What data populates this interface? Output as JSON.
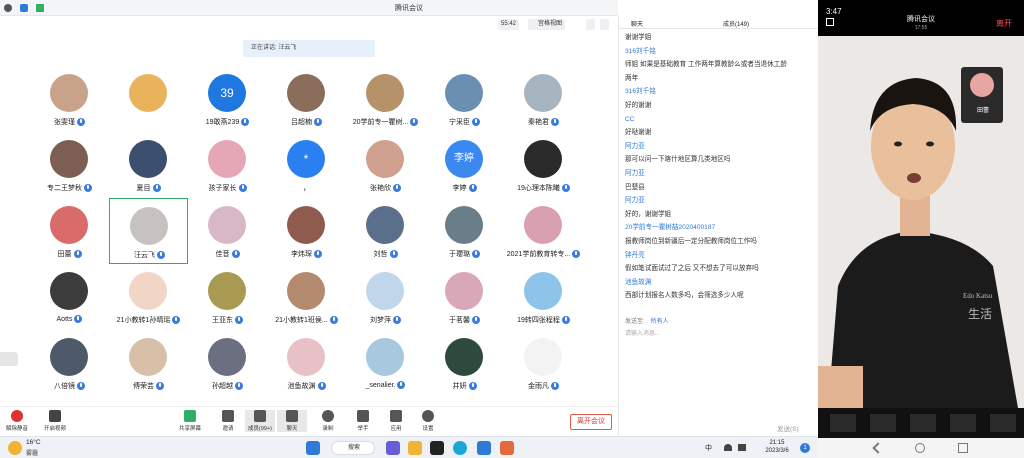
{
  "app": {
    "title": "腾讯会议"
  },
  "toolbar": {
    "timer": "55:42",
    "view_label": "宫格视图"
  },
  "speaking": "正在讲话: 汪云飞",
  "participants": [
    [
      "张雯瑾",
      "",
      "19敢燕239",
      "吕超楠",
      "20学前专一瞿树...",
      "宁采臣",
      "秦艳君"
    ],
    [
      "专二王梦秋",
      "夏目",
      "孩子家长",
      "，",
      "张艳欣",
      "李婷",
      "19心理本陈曦"
    ],
    [
      "田蕾",
      "汪云飞",
      "佳音",
      "李炜琛",
      "刘哲",
      "于瓔璐",
      "2021学前教育转专..."
    ],
    [
      "Aotts",
      "21小教转1孙晴瑶",
      "王亚东",
      "21小教转1班侯...",
      "刘梦萍",
      "于茗馨",
      "19转四张程程"
    ],
    [
      "八倍镜",
      "傅荣芸",
      "孙超越",
      "池鱼故渊",
      "_senalier.",
      "井妍",
      "金雨凡"
    ]
  ],
  "avatar_badges": {
    "number": "39",
    "text": "李婷",
    "star": "*"
  },
  "bottom_toolbar": {
    "mute": "解除静音",
    "video": "开启视频",
    "share": "共享屏幕",
    "invite": "邀请",
    "members": "成员(99+)",
    "chat": "聊天",
    "record": "录制",
    "hand": "举手",
    "apps": "应用",
    "settings": "设置",
    "leave": "离开会议"
  },
  "chat": {
    "tab_chat": "聊天",
    "tab_members": "成员(149)",
    "messages": [
      {
        "type": "text",
        "value": "谢谢学姐"
      },
      {
        "type": "user",
        "value": "316刘千铭"
      },
      {
        "type": "text",
        "value": "师姐 如果是基础教育 工作两年算教龄么或者当退休工龄"
      },
      {
        "type": "text",
        "value": "两年"
      },
      {
        "type": "user",
        "value": "316刘千铭"
      },
      {
        "type": "text",
        "value": "好的谢谢"
      },
      {
        "type": "user",
        "value": "CC"
      },
      {
        "type": "text",
        "value": "好哒谢谢"
      },
      {
        "type": "user",
        "value": "阿力亚"
      },
      {
        "type": "text",
        "value": "那可以问一下喀什地区算几类地区吗"
      },
      {
        "type": "user",
        "value": "阿力亚"
      },
      {
        "type": "text",
        "value": "巴楚县"
      },
      {
        "type": "user",
        "value": "阿力亚"
      },
      {
        "type": "text",
        "value": "好的，谢谢学姐"
      },
      {
        "type": "user",
        "value": "20学前专一瞿树喆2020400187"
      },
      {
        "type": "text",
        "value": "报教师岗位到新疆后一定分配教师岗位工作吗"
      },
      {
        "type": "user",
        "value": "钟丹亮"
      },
      {
        "type": "text",
        "value": "假如笔试面试过了之后 又不想去了可以放弃吗"
      },
      {
        "type": "user",
        "value": "池鱼故渊"
      },
      {
        "type": "text",
        "value": "西部计划报名人数多吗，会筛选多少人呢"
      }
    ],
    "send_to_label": "发送至:",
    "send_to_value": "所有人",
    "input_placeholder": "请输入消息...",
    "send_button": "发送(S)"
  },
  "phone": {
    "time": "3:47",
    "title": "腾讯会议",
    "subtitle": "17:55",
    "leave": "离开",
    "pip_name": "田蕾",
    "shirt_text": "Edo Katsu",
    "shirt_logo": "生活"
  },
  "taskbar": {
    "weather_temp": "16°C",
    "weather_desc": "雾霾",
    "search": "搜索",
    "ime": "中",
    "time": "21:15",
    "date": "2023/3/6",
    "notif": "1"
  },
  "colors": {
    "accent": "#3a7be0",
    "leave": "#d33333",
    "selected": "#2fae6a"
  }
}
